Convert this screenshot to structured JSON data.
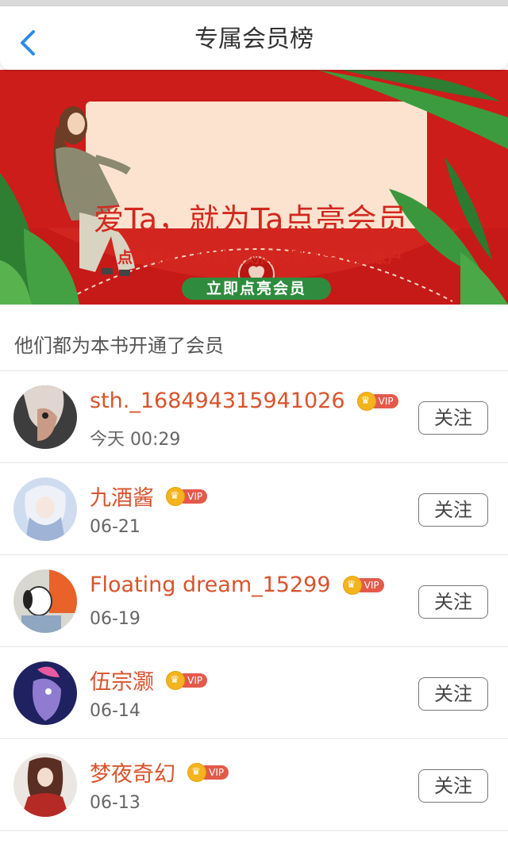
{
  "header": {
    "title": "专属会员榜"
  },
  "banner": {
    "title": "爱Ta，就为Ta点亮会员",
    "subtitle": "点亮成功，收益立刻同步到作者大大账户",
    "button_label": "立即点亮会员"
  },
  "section": {
    "label": "他们都为本书开通了会员"
  },
  "vip_label": "VIP",
  "follow_label": "关注",
  "members": [
    {
      "name": "sth._168494315941026",
      "date": "今天 00:29",
      "avatar_color": "#5b5b5b"
    },
    {
      "name": "九酒酱",
      "date": "06-21",
      "avatar_color": "#b8c9e6"
    },
    {
      "name": "Floating dream_15299",
      "date": "06-19",
      "avatar_color": "#e0783c"
    },
    {
      "name": "伍宗灏",
      "date": "06-14",
      "avatar_color": "#2c2b6e"
    },
    {
      "name": "梦夜奇幻",
      "date": "06-13",
      "avatar_color": "#c9c3c0"
    }
  ]
}
